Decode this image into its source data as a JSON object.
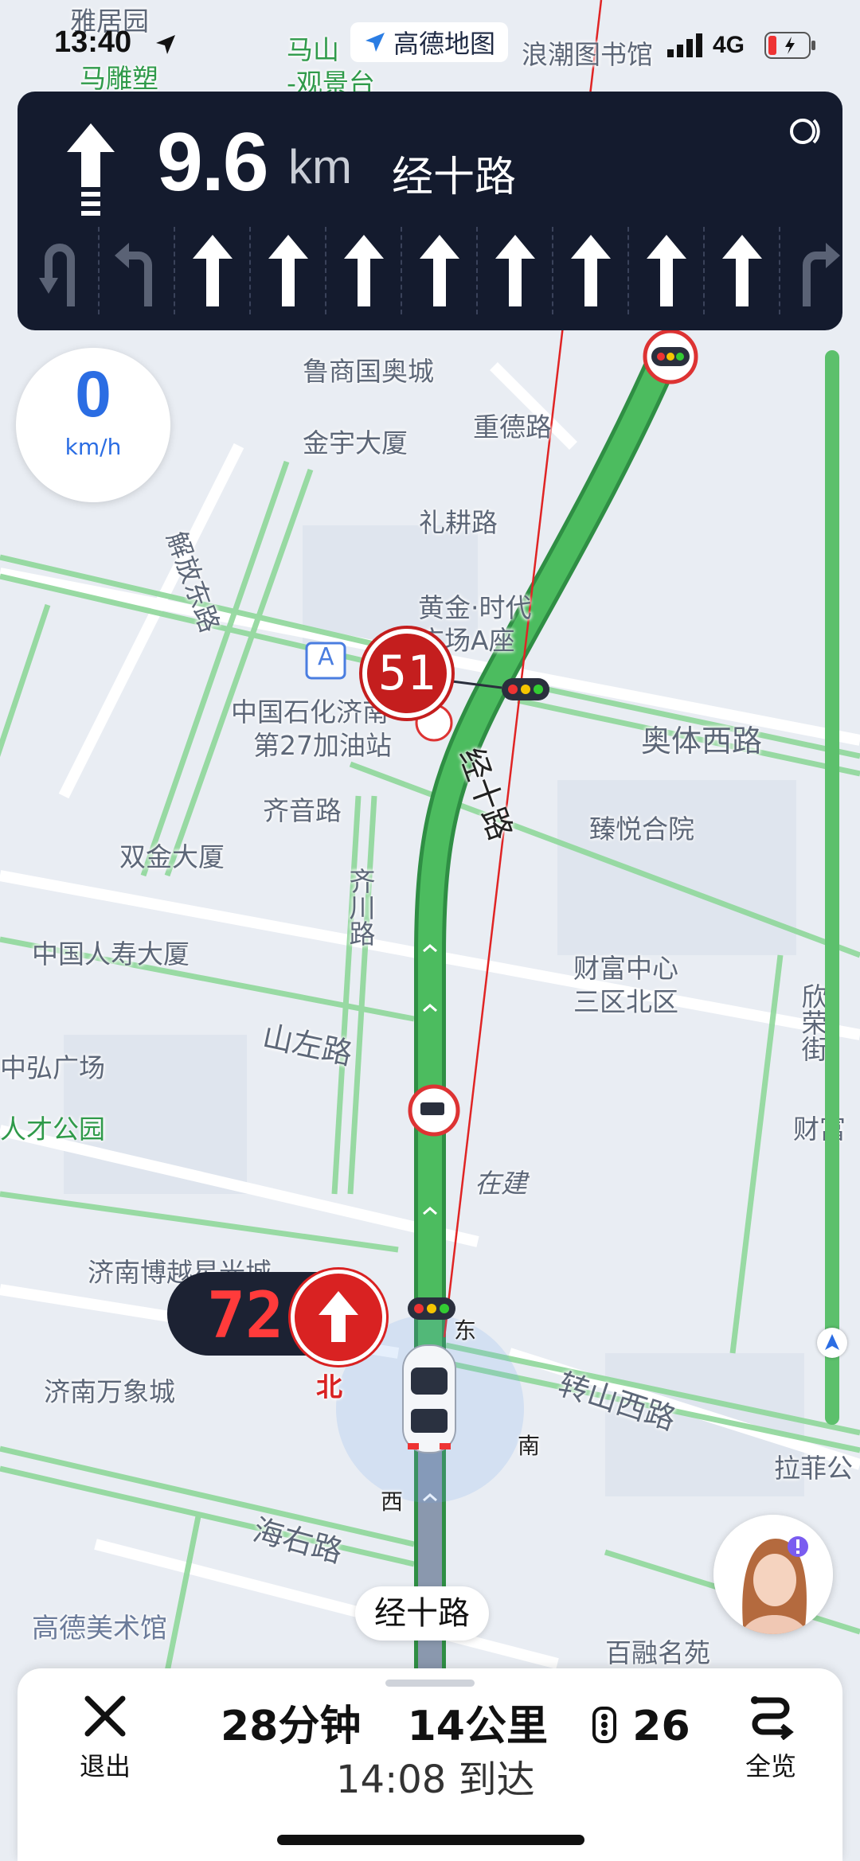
{
  "status_bar": {
    "time": "13:40",
    "app_tag": "高德地图",
    "network": "4G"
  },
  "nav": {
    "distance_value": "9.6",
    "distance_unit": "km",
    "road": "经十路",
    "lanes": [
      "left-uturn",
      "left",
      "straight",
      "straight",
      "straight",
      "straight",
      "straight",
      "straight",
      "straight",
      "straight",
      "right"
    ]
  },
  "speed": {
    "value": "0",
    "unit": "km/h"
  },
  "speed_limits": {
    "ahead": "51",
    "current": "72"
  },
  "map_labels": {
    "yajuyuan": "雅居园",
    "madiaosu": "马雕塑",
    "mashan": "马山",
    "guanjingtai": "-观景台",
    "langchao": "浪潮图书馆",
    "lushang": "鲁商国奥城",
    "jinyu": "金宇大厦",
    "zhongde": "重德路",
    "ligeng": "礼耕路",
    "huangjin_1": "黄金·时代",
    "huangjin_2": "广场A座",
    "jiefang": "解放东路",
    "sinopec_1": "中国石化济南",
    "sinopec_2": "第27加油站",
    "aoti": "奥体西路",
    "jingshi_v": "经十路",
    "qiyin": "齐音路",
    "shuangjin": "双金大厦",
    "zhenyue": "臻悦合院",
    "qichuan": "齐川路",
    "renshou": "中国人寿大厦",
    "caifu_1": "财富中心",
    "caifu_2": "三区北区",
    "shanzuo": "山左路",
    "zhonghong": "中弘广场",
    "rencai": "人才公园",
    "xinrong": "欣荣街",
    "zaijian": "在建",
    "caifu_r": "财富",
    "bowuguan": "济南博越星光城",
    "wanxiang": "济南万象城",
    "zhuanshan": "转山西路",
    "haiyou": "海右路",
    "lafei": "拉菲公",
    "bairong": "百融名苑",
    "art_museum": "高德美术馆",
    "dir_n": "北",
    "dir_e": "东",
    "dir_s": "南",
    "dir_w": "西",
    "poi_a": "A"
  },
  "current_road_pill": "经十路",
  "bottom": {
    "exit_label": "退出",
    "trip_time": "28分钟",
    "trip_dist": "14公里",
    "lights": "26",
    "arrival": "14:08 到达",
    "overview_label": "全览"
  },
  "colors": {
    "route_green": "#4cbc5f",
    "nav_bg": "#141b2e",
    "limit_red": "#c41e1e",
    "speed_blue": "#2b6de3"
  }
}
